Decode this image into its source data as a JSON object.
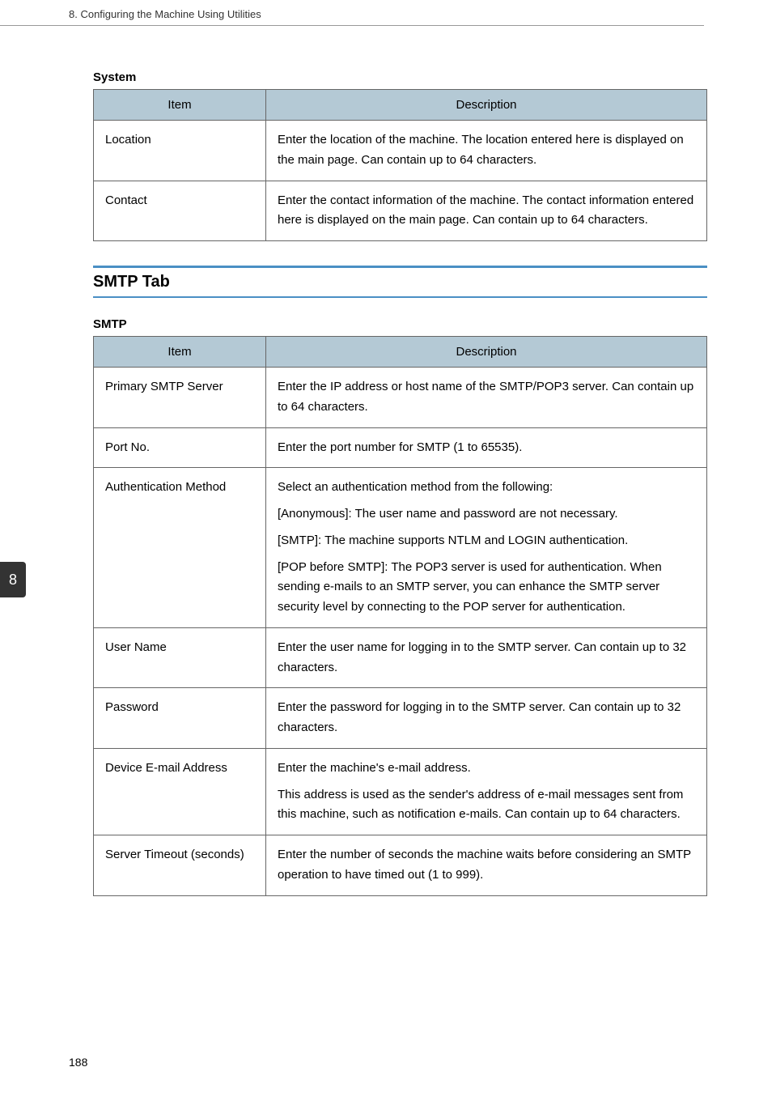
{
  "header": {
    "chapter_title": "8. Configuring the Machine Using Utilities"
  },
  "side_tab": "8",
  "page_number": "188",
  "tables": {
    "system": {
      "title": "System",
      "columns": {
        "item": "Item",
        "description": "Description"
      },
      "rows": [
        {
          "item": "Location",
          "description": "Enter the location of the machine. The location entered here is displayed on the main page. Can contain up to 64 characters."
        },
        {
          "item": "Contact",
          "description": "Enter the contact information of the machine. The contact information entered here is displayed on the main page. Can contain up to 64 characters."
        }
      ]
    },
    "smtp": {
      "section_heading": "SMTP Tab",
      "title": "SMTP",
      "columns": {
        "item": "Item",
        "description": "Description"
      },
      "rows": [
        {
          "item": "Primary SMTP Server",
          "paras": [
            "Enter the IP address or host name of the SMTP/POP3 server. Can contain up to 64 characters."
          ]
        },
        {
          "item": "Port No.",
          "paras": [
            "Enter the port number for SMTP (1 to 65535)."
          ]
        },
        {
          "item": "Authentication Method",
          "paras": [
            "Select an authentication method from the following:",
            "[Anonymous]: The user name and password are not necessary.",
            "[SMTP]: The machine supports NTLM and LOGIN authentication.",
            "[POP before SMTP]: The POP3 server is used for authentication. When sending e-mails to an SMTP server, you can enhance the SMTP server security level by connecting to the POP server for authentication."
          ]
        },
        {
          "item": "User Name",
          "paras": [
            "Enter the user name for logging in to the SMTP server. Can contain up to 32 characters."
          ]
        },
        {
          "item": "Password",
          "paras": [
            "Enter the password for logging in to the SMTP server. Can contain up to 32 characters."
          ]
        },
        {
          "item": "Device E-mail Address",
          "paras": [
            "Enter the machine's e-mail address.",
            "This address is used as the sender's address of e-mail messages sent from this machine, such as notification e-mails. Can contain up to 64 characters."
          ]
        },
        {
          "item": "Server Timeout (seconds)",
          "paras": [
            "Enter the number of seconds the machine waits before considering an SMTP operation to have timed out (1 to 999)."
          ]
        }
      ]
    }
  }
}
